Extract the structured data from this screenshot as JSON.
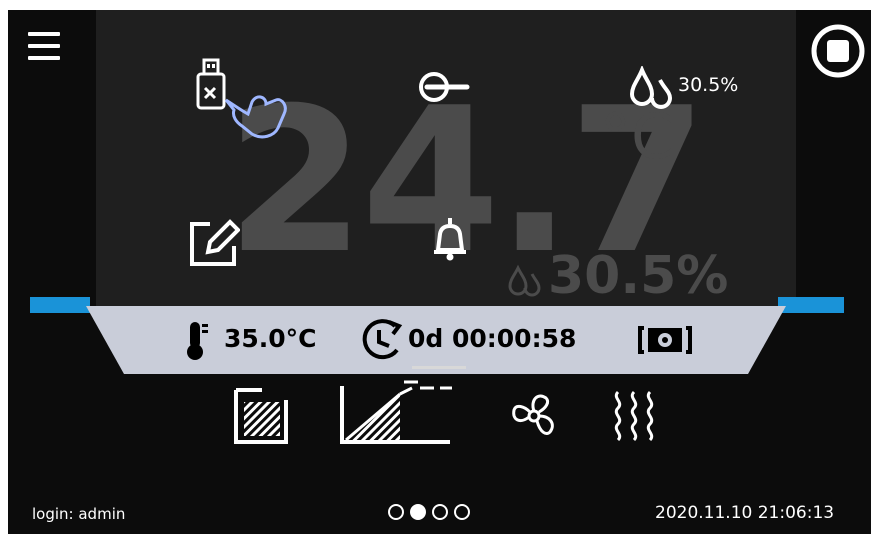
{
  "display": {
    "temperature": "24.7",
    "temperature_unit": "°C",
    "humidity": "30.5%"
  },
  "overlay": {
    "humidity_reading": "30.5%",
    "icons": [
      "usb-eject-icon",
      "hand-pointer-icon",
      "logout-icon",
      "humidity-drops-icon",
      "edit-icon",
      "alarm-bell-icon"
    ]
  },
  "status_bar": {
    "set_temperature": "35.0°C",
    "timer": "0d 00:00:58",
    "icons": [
      "thermometer-icon",
      "timer-icon",
      "camera-settings-icon"
    ]
  },
  "bottom_bar": {
    "icons": [
      "chamber-program-icon",
      "ramp-profile-icon",
      "fan-icon",
      "heating-icon"
    ]
  },
  "footer": {
    "login": "login: admin",
    "datetime": "2020.11.10  21:06:13",
    "page_count": 4,
    "active_page": 2
  },
  "colors": {
    "accent_blue": "#1a93d8",
    "status_bg": "#c9cdd9",
    "screen_bg": "#0c0c0c",
    "dim_text": "#4b4b4b"
  }
}
